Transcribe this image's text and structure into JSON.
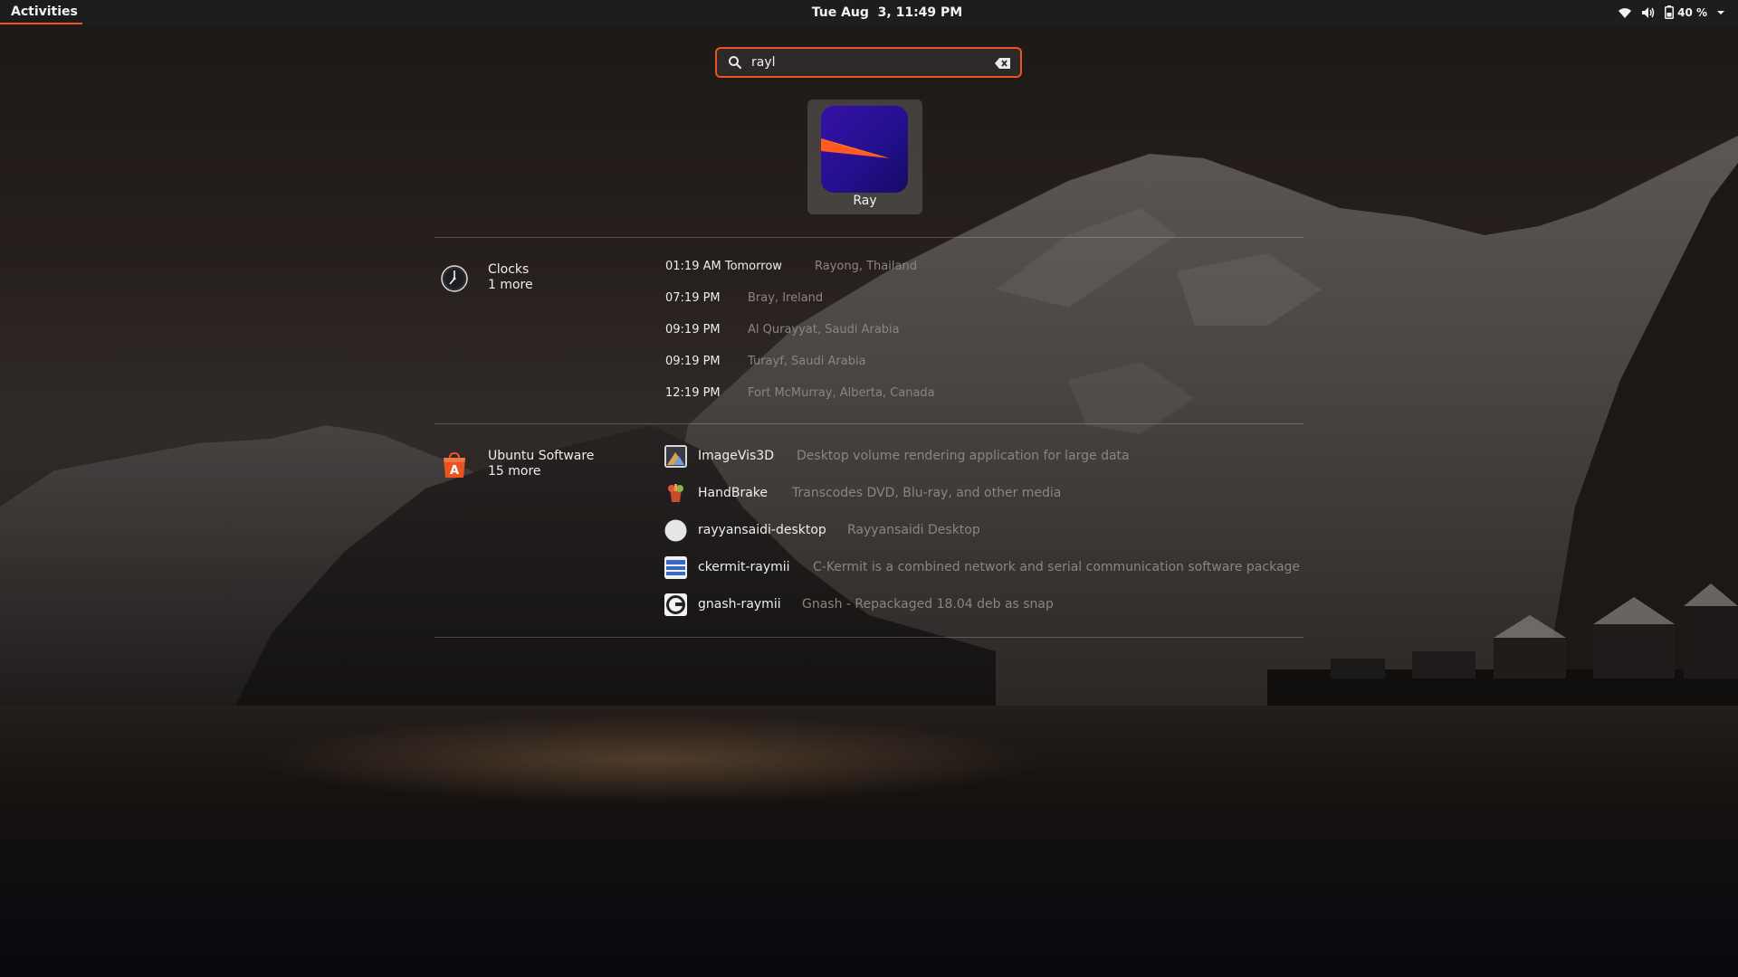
{
  "topbar": {
    "activities_label": "Activities",
    "datetime": "Tue Aug  3, 11:49 PM",
    "battery_percent": "40 %",
    "icons": [
      "wifi-icon",
      "volume-icon",
      "battery-icon",
      "chevron-down-icon"
    ]
  },
  "search": {
    "value": "rayl",
    "icons": [
      "search-icon",
      "clear-icon"
    ]
  },
  "app_results": [
    {
      "label": "Ray"
    }
  ],
  "clocks": {
    "provider_name": "Clocks",
    "more_label": "1 more",
    "rows": [
      {
        "time": "01:19 AM Tomorrow",
        "location": "Rayong, Thailand"
      },
      {
        "time": "07:19 PM",
        "location": "Bray, Ireland"
      },
      {
        "time": "09:19 PM",
        "location": "Al Qurayyat, Saudi Arabia"
      },
      {
        "time": "09:19 PM",
        "location": "Turayf, Saudi Arabia"
      },
      {
        "time": "12:19 PM",
        "location": "Fort McMurray, Alberta, Canada"
      }
    ]
  },
  "software": {
    "provider_name": "Ubuntu Software",
    "more_label": "15 more",
    "rows": [
      {
        "name": "ImageVis3D",
        "description": "Desktop volume rendering application for large data"
      },
      {
        "name": "HandBrake",
        "description": "Transcodes DVD, Blu-ray, and other media"
      },
      {
        "name": "rayyansaidi-desktop",
        "description": "Rayyansaidi Desktop"
      },
      {
        "name": "ckermit-raymii",
        "description": "C-Kermit is a combined network and serial communication software package"
      },
      {
        "name": "gnash-raymii",
        "description": "Gnash - Repackaged 18.04 deb as snap"
      }
    ]
  },
  "colors": {
    "accent": "#e95420",
    "topbar_bg": "#1d1d1d",
    "app_icon_bg": "#2a12a0"
  }
}
